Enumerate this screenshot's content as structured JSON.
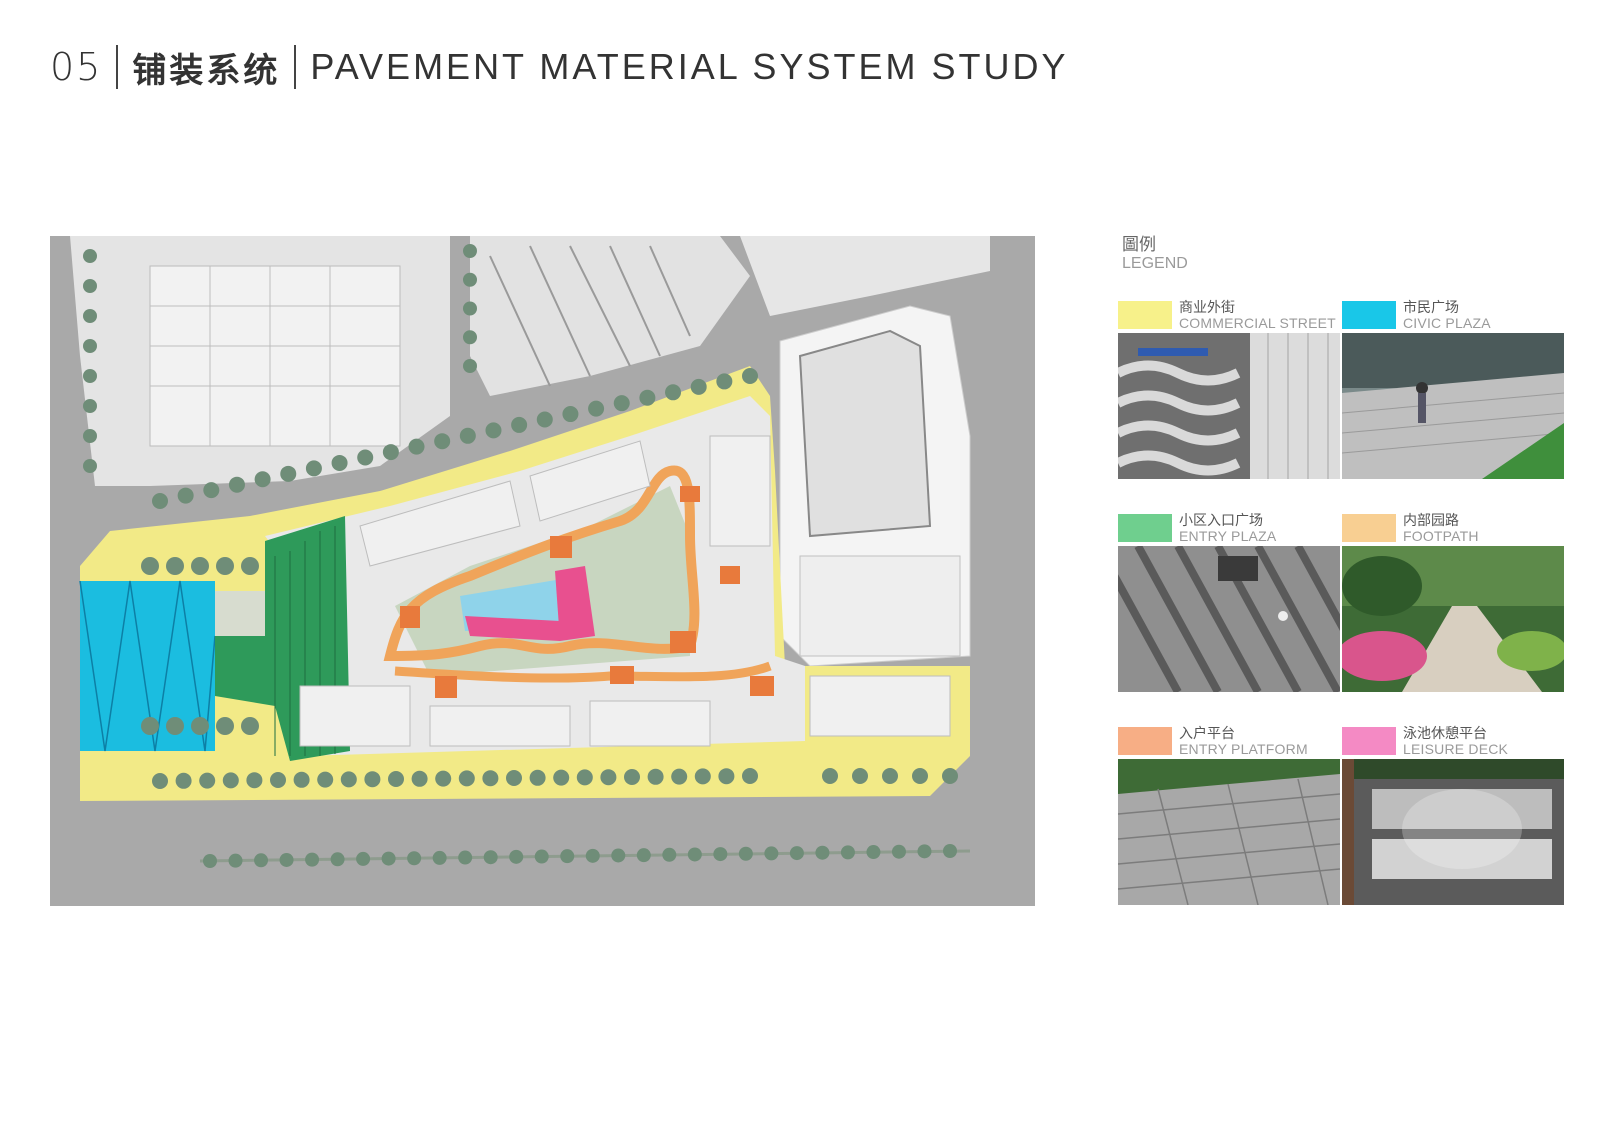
{
  "header": {
    "number": "05",
    "title_cn": "铺装系统",
    "title_en": "PAVEMENT MATERIAL SYSTEM STUDY"
  },
  "legend": {
    "title_cn": "圖例",
    "title_en": "LEGEND",
    "items": [
      {
        "cn": "商业外街",
        "en": "COMMERCIAL STREET",
        "color": "#f7f18a"
      },
      {
        "cn": "市民广场",
        "en": "CIVIC PLAZA",
        "color": "#19c7e8"
      },
      {
        "cn": "小区入口广场",
        "en": "ENTRY PLAZA",
        "color": "#6fcf8e"
      },
      {
        "cn": "内部园路",
        "en": "FOOTPATH",
        "color": "#f8cf92"
      },
      {
        "cn": "入户平台",
        "en": "ENTRY PLATFORM",
        "color": "#f7ae85"
      },
      {
        "cn": "泳池休憩平台",
        "en": "LEISURE DECK",
        "color": "#f48ac4"
      }
    ]
  },
  "plan": {
    "colors": {
      "road": "#a9a9a9",
      "commercial": "#f2ea87",
      "civic": "#1bbde0",
      "entry_plaza": "#2e9a5a",
      "footpath": "#f0a45a",
      "platform": "#e87a3c",
      "deck": "#e8508f",
      "pool": "#8fd3ea",
      "building": "#ececec",
      "tree": "#6f8d78"
    }
  }
}
